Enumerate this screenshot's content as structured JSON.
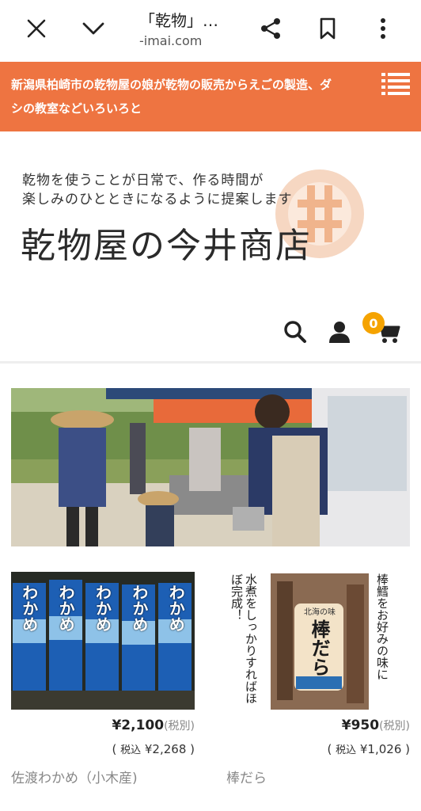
{
  "browser": {
    "title": "「乾物」…",
    "url": "-imai.com"
  },
  "banner": {
    "text": "新潟県柏崎市の乾物屋の娘が乾物の販売からえごの製造、ダシの教室などいろいろと"
  },
  "header": {
    "tagline_line1": "乾物を使うことが日常で、作る時間が",
    "tagline_line2": "楽しみのひとときになるように提案します",
    "shop_name": "乾物屋の今井商店"
  },
  "cart": {
    "count": "0"
  },
  "products": [
    {
      "name": "佐渡わかめ（小木産)",
      "price": "¥2,100",
      "tax_note": "(税別)",
      "tax_in_prefix": "( ",
      "tax_in_label": "税込",
      "tax_in_value": " ¥2,268 )",
      "package_label": "わかめ"
    },
    {
      "name": "棒だら",
      "price": "¥950",
      "tax_note": "(税別)",
      "tax_in_prefix": "( ",
      "tax_in_label": "税込",
      "tax_in_value": " ¥1,026 )",
      "package_label": "棒だら",
      "package_sub": "北海の味",
      "caption_right": "棒鱈をお好みの味に",
      "caption_left": "水煮をしっかりすればほぼ完成！"
    }
  ],
  "colors": {
    "accent_orange": "#ee7441",
    "badge": "#f5a300"
  }
}
